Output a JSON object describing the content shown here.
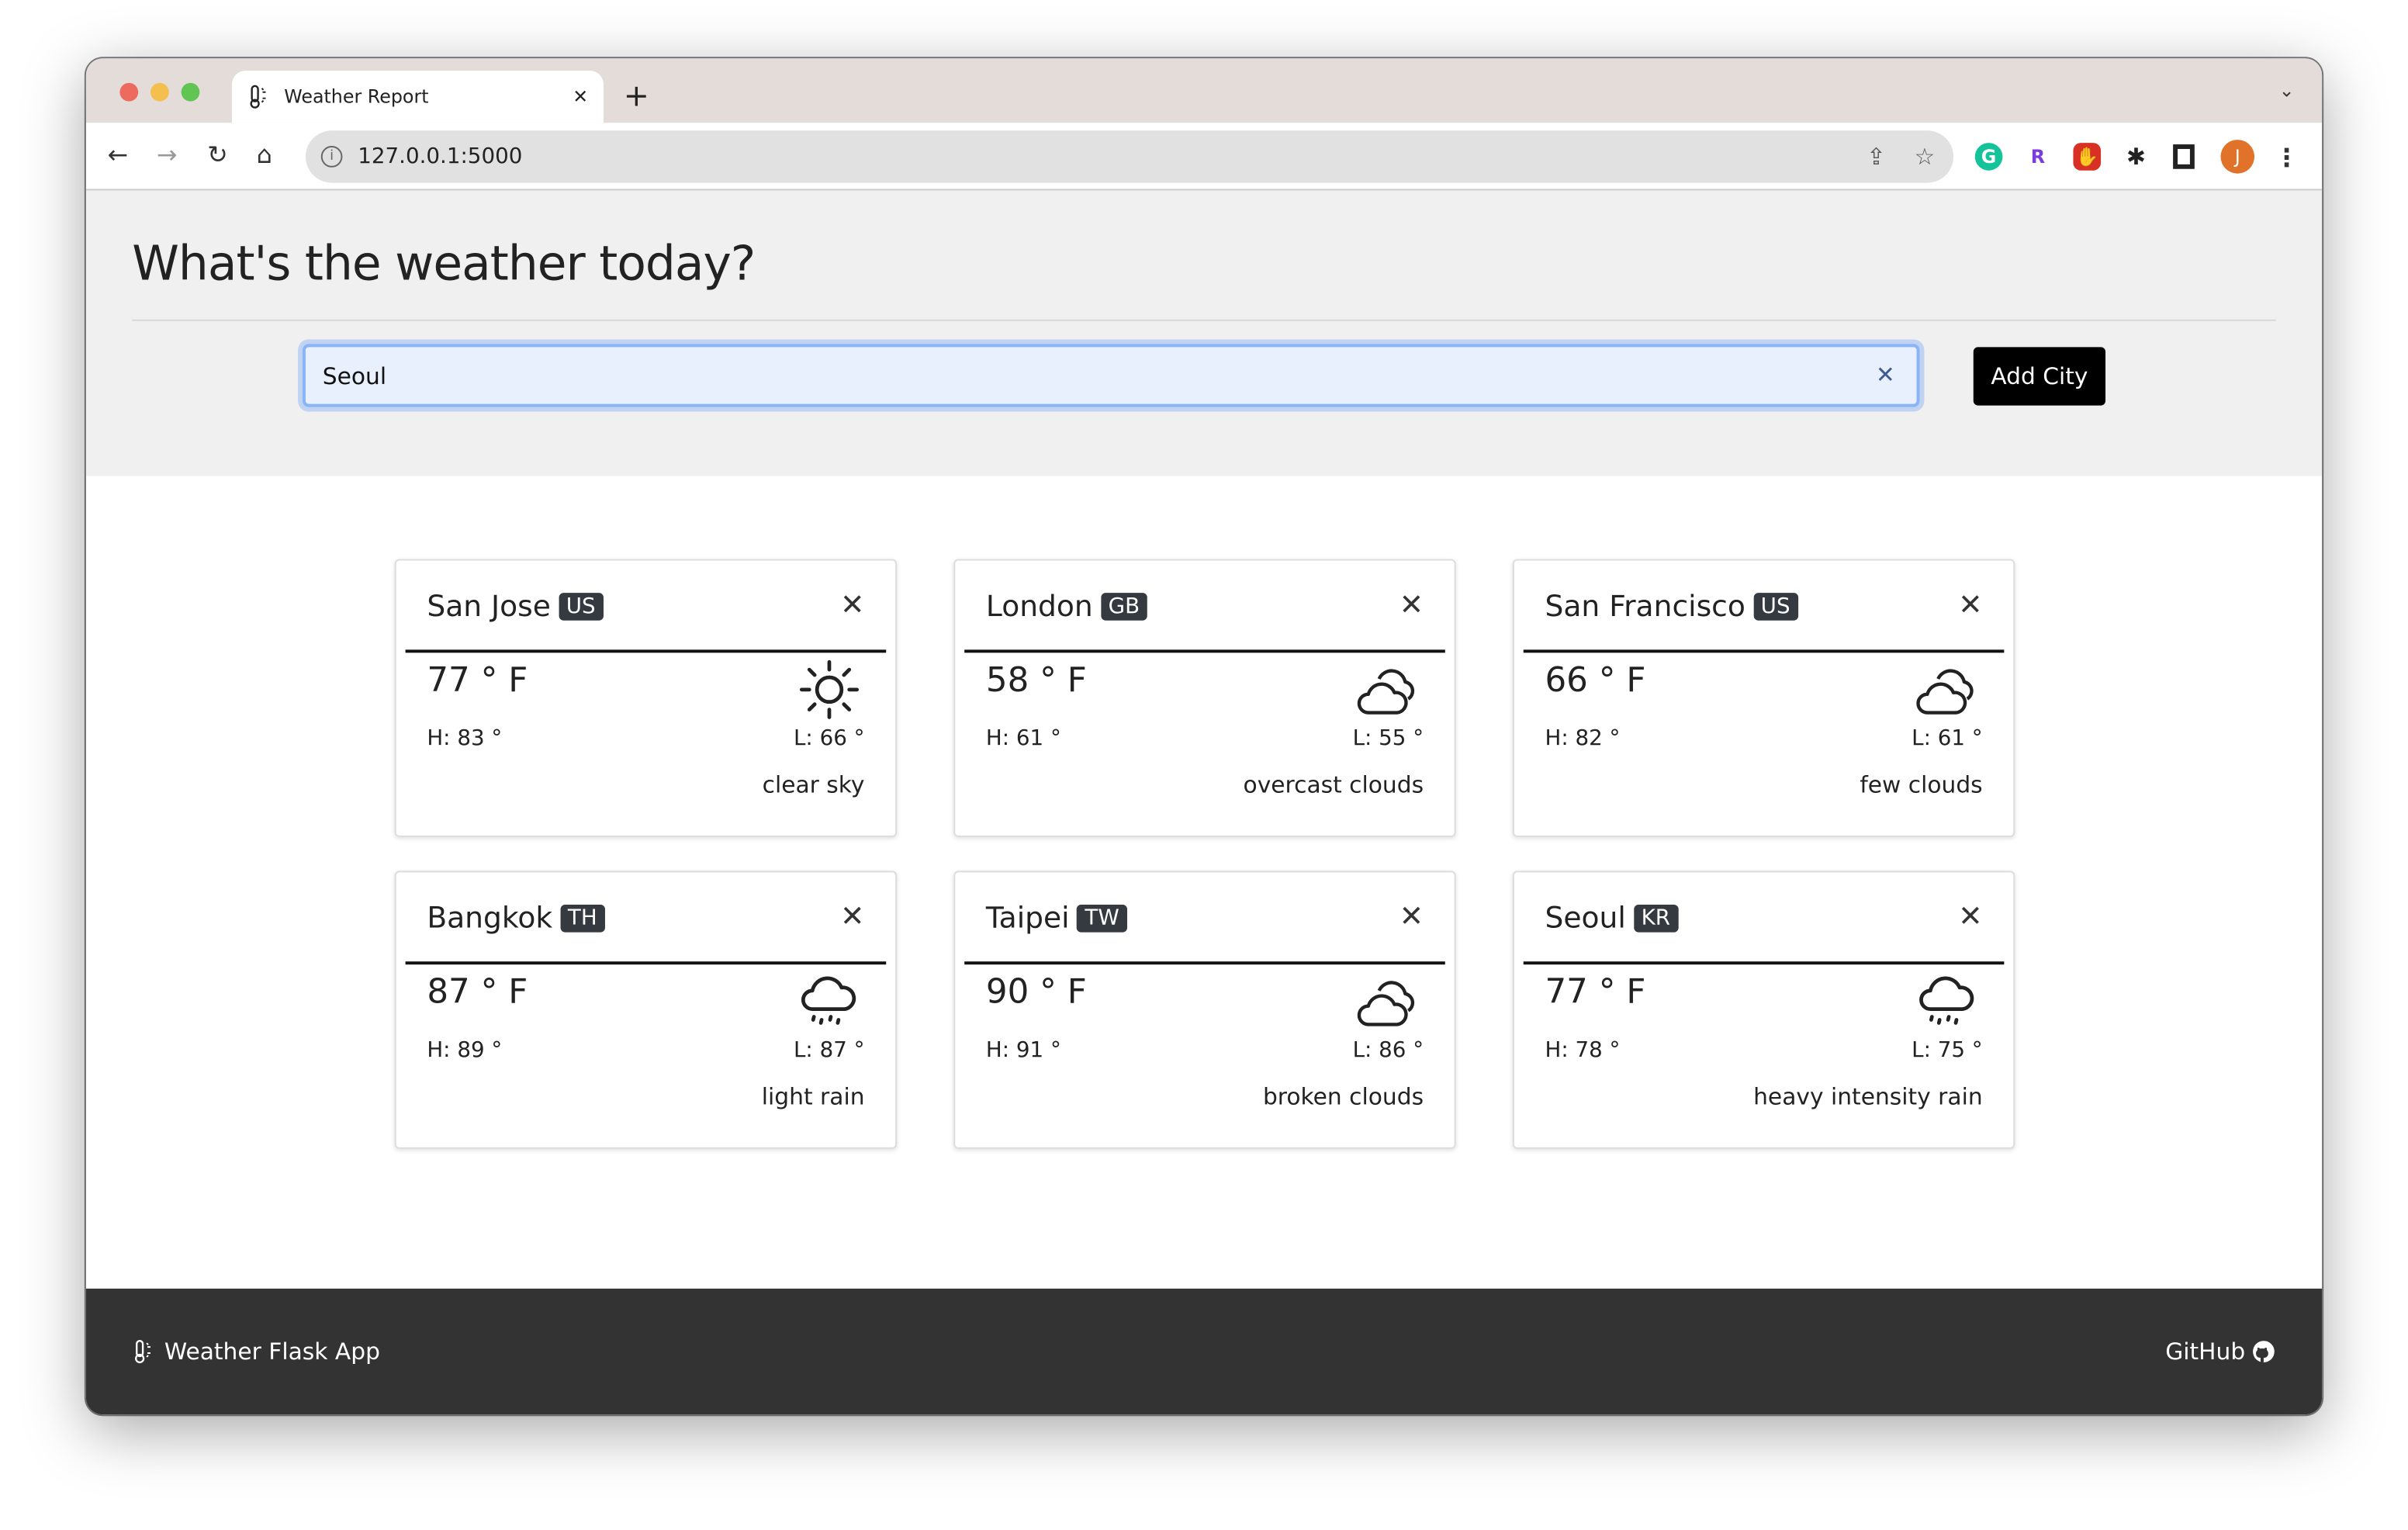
{
  "browser": {
    "tab_title": "Weather Report",
    "url": "127.0.0.1:5000",
    "profile_initial": "J",
    "extensions": [
      "grammarly-icon",
      "r-extension-icon",
      "adblock-icon",
      "puzzle-icon",
      "sidepanel-icon"
    ]
  },
  "header": {
    "title": "What's the weather today?",
    "search_value": "Seoul",
    "add_button": "Add City"
  },
  "cards": [
    {
      "city": "San Jose",
      "country": "US",
      "temp": "77 ° F",
      "high": "H: 83 °",
      "low": "L: 66 °",
      "description": "clear sky",
      "icon": "sun-icon"
    },
    {
      "city": "London",
      "country": "GB",
      "temp": "58 ° F",
      "high": "H: 61 °",
      "low": "L: 55 °",
      "description": "overcast clouds",
      "icon": "clouds-icon"
    },
    {
      "city": "San Francisco",
      "country": "US",
      "temp": "66 ° F",
      "high": "H: 82 °",
      "low": "L: 61 °",
      "description": "few clouds",
      "icon": "clouds-icon"
    },
    {
      "city": "Bangkok",
      "country": "TH",
      "temp": "87 ° F",
      "high": "H: 89 °",
      "low": "L: 87 °",
      "description": "light rain",
      "icon": "cloud-rain-icon"
    },
    {
      "city": "Taipei",
      "country": "TW",
      "temp": "90 ° F",
      "high": "H: 91 °",
      "low": "L: 86 °",
      "description": "broken clouds",
      "icon": "clouds-icon"
    },
    {
      "city": "Seoul",
      "country": "KR",
      "temp": "77 ° F",
      "high": "H: 78 °",
      "low": "L: 75 °",
      "description": "heavy intensity rain",
      "icon": "cloud-rain-icon"
    }
  ],
  "footer": {
    "brand": "Weather Flask App",
    "github": "GitHub"
  }
}
